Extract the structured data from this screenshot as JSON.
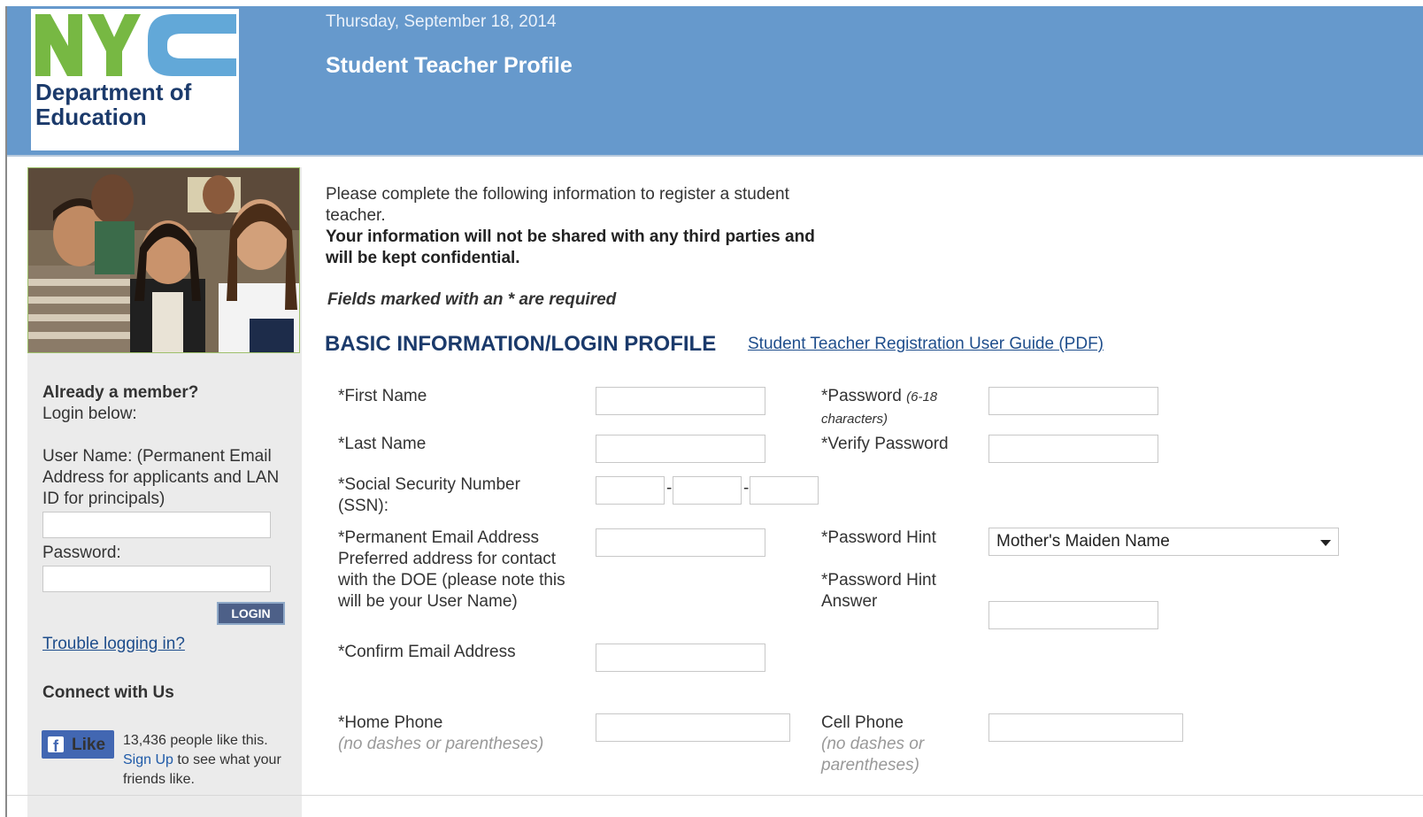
{
  "header": {
    "logo": {
      "acronym": "NYC",
      "line1": "Department of",
      "line2": "Education"
    },
    "date": "Thursday, September 18, 2014",
    "title": "Student Teacher Profile",
    "colors": {
      "banner": "#6699cc",
      "logo_green": "#77b843",
      "logo_blue": "#62a8d8",
      "dept_text": "#1b3a6b"
    }
  },
  "sidebar": {
    "already_member": "Already a member?",
    "login_below": "Login below:",
    "username_label": "User Name: (Permanent Email Address for applicants and LAN ID for principals)",
    "username_value": "",
    "password_label": "Password:",
    "password_value": "",
    "login_button": "LOGIN",
    "trouble_link": "Trouble logging in?",
    "connect": "Connect with Us",
    "facebook": {
      "like_label": "Like",
      "count_text": "13,436 people like this.",
      "signup_link": "Sign Up",
      "signup_rest": " to see what your friends like."
    }
  },
  "main": {
    "intro_line": "Please complete the following information to register a student teacher.",
    "intro_bold": "Your information will not be shared with any third parties and will be kept confidential.",
    "required_note": "Fields marked with an * are required",
    "section_title": "BASIC INFORMATION/LOGIN PROFILE",
    "guide_link": "Student Teacher Registration User Guide (PDF)",
    "fields": {
      "first_name": {
        "label": "*First Name",
        "value": ""
      },
      "last_name": {
        "label": "*Last Name",
        "value": ""
      },
      "ssn": {
        "label": "*Social Security Number (SSN):",
        "part1": "",
        "part2": "",
        "part3": "",
        "separator": "-"
      },
      "email": {
        "label_line1": "*Permanent Email Address",
        "label_rest": " Preferred address for contact with the DOE (please note this will be your User Name)",
        "value": ""
      },
      "confirm_email": {
        "label": "*Confirm Email Address",
        "value": ""
      },
      "home_phone": {
        "label": "*Home Phone",
        "hint": "(no dashes or parentheses)",
        "value": ""
      },
      "password": {
        "label": "*Password",
        "hint": "(6-18 characters)",
        "value": ""
      },
      "verify_password": {
        "label": "*Verify Password",
        "value": ""
      },
      "password_hint": {
        "label": "*Password Hint",
        "selected": "Mother's Maiden Name"
      },
      "password_hint_answer": {
        "label": "*Password Hint Answer",
        "value": ""
      },
      "cell_phone": {
        "label": "Cell Phone",
        "hint": "(no dashes or parentheses)",
        "value": ""
      }
    }
  }
}
